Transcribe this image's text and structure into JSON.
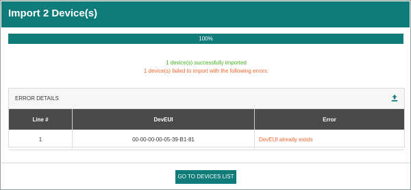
{
  "dialog": {
    "title": "Import 2 Device(s)"
  },
  "progress": {
    "percent": 100,
    "label": "100%"
  },
  "messages": {
    "success": "1 device(s) successfully imported",
    "error": "1 device(s) failed to import with the following errors:"
  },
  "error_panel": {
    "title": "ERROR DETAILS",
    "icon": "upload-icon",
    "columns": [
      "Line #",
      "DevEUI",
      "Error"
    ],
    "rows": [
      [
        "1",
        "00-00-00-00-05-39-B1-81",
        "DevEUI already exists"
      ]
    ]
  },
  "footer": {
    "button_label": "GO TO DEVICES LIST"
  },
  "colors": {
    "accent": "#0f7c79",
    "success": "#43b31c",
    "error": "#f0662f",
    "table_header": "#4a4a4a"
  }
}
